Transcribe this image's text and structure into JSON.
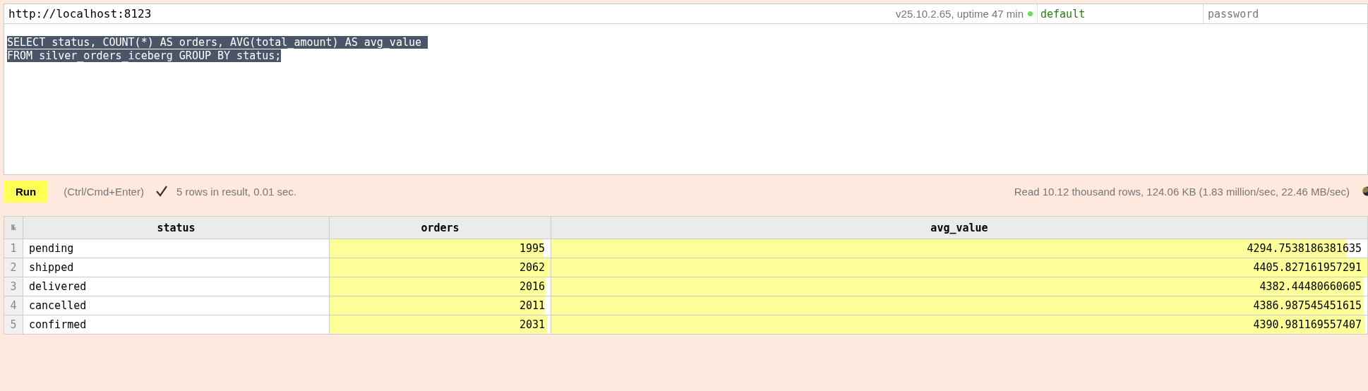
{
  "connection": {
    "url": "http://localhost:8123",
    "server_info": "v25.10.2.65, uptime 47 min",
    "online": true,
    "user": "default",
    "password_placeholder": "password"
  },
  "query": {
    "selected": true,
    "lines": [
      "SELECT status, COUNT(*) AS orders, AVG(total_amount) AS avg_value ",
      "FROM silver_orders_iceberg GROUP BY status;"
    ]
  },
  "run_bar": {
    "button": "Run",
    "hint": "(Ctrl/Cmd+Enter)",
    "succeeded": true,
    "result": "5 rows in result, 0.01 sec.",
    "stats": "Read 10.12 thousand rows, 124.06 KB (1.83 million/sec, 22.46 MB/sec)"
  },
  "table": {
    "index_header": "№",
    "columns": [
      {
        "name": "status",
        "kind": "text"
      },
      {
        "name": "orders",
        "kind": "number"
      },
      {
        "name": "avg_value",
        "kind": "number"
      }
    ],
    "rows": [
      {
        "index": "1",
        "cells": [
          {
            "text": "pending"
          },
          {
            "text": "1995",
            "level": 0.9675
          },
          {
            "text": "4294.7538186381635",
            "level": 0.975
          }
        ]
      },
      {
        "index": "2",
        "cells": [
          {
            "text": "shipped"
          },
          {
            "text": "2062",
            "level": 1
          },
          {
            "text": "4405.827161957291",
            "level": 1
          }
        ]
      },
      {
        "index": "3",
        "cells": [
          {
            "text": "delivered"
          },
          {
            "text": "2016",
            "level": 0.978
          },
          {
            "text": "4382.44480660605",
            "level": 0.995
          }
        ]
      },
      {
        "index": "4",
        "cells": [
          {
            "text": "cancelled"
          },
          {
            "text": "2011",
            "level": 0.975
          },
          {
            "text": "4386.987545451615",
            "level": 0.996
          }
        ]
      },
      {
        "index": "5",
        "cells": [
          {
            "text": "confirmed"
          },
          {
            "text": "2031",
            "level": 0.985
          },
          {
            "text": "4390.981169557407",
            "level": 0.997
          }
        ]
      }
    ]
  }
}
